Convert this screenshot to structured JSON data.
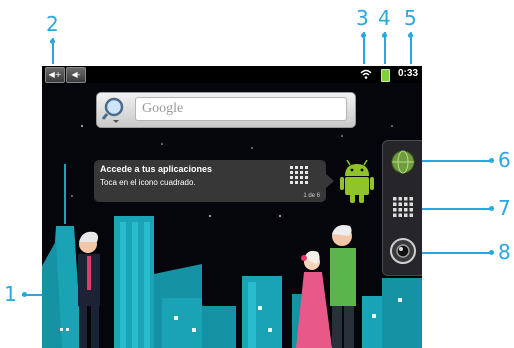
{
  "callouts": [
    "1",
    "2",
    "3",
    "4",
    "5",
    "6",
    "7",
    "8"
  ],
  "status_bar": {
    "volume_up_label": "◀+",
    "volume_down_label": "◀-",
    "time": "0:33"
  },
  "search_widget": {
    "placeholder": "Google"
  },
  "tooltip": {
    "title": "Accede a tus aplicaciones",
    "text": "Toca en el icono cuadrado.",
    "page": "1 de 6"
  },
  "launcher": {
    "icons": [
      "browser-globe-icon",
      "app-grid-icon",
      "camera-icon"
    ]
  },
  "colors": {
    "accent": "#2aa7e0",
    "wallpaper": "#05060c",
    "city_teal": "#1aa3b4",
    "battery": "#7bd13a",
    "android_green": "#8fc42b"
  }
}
